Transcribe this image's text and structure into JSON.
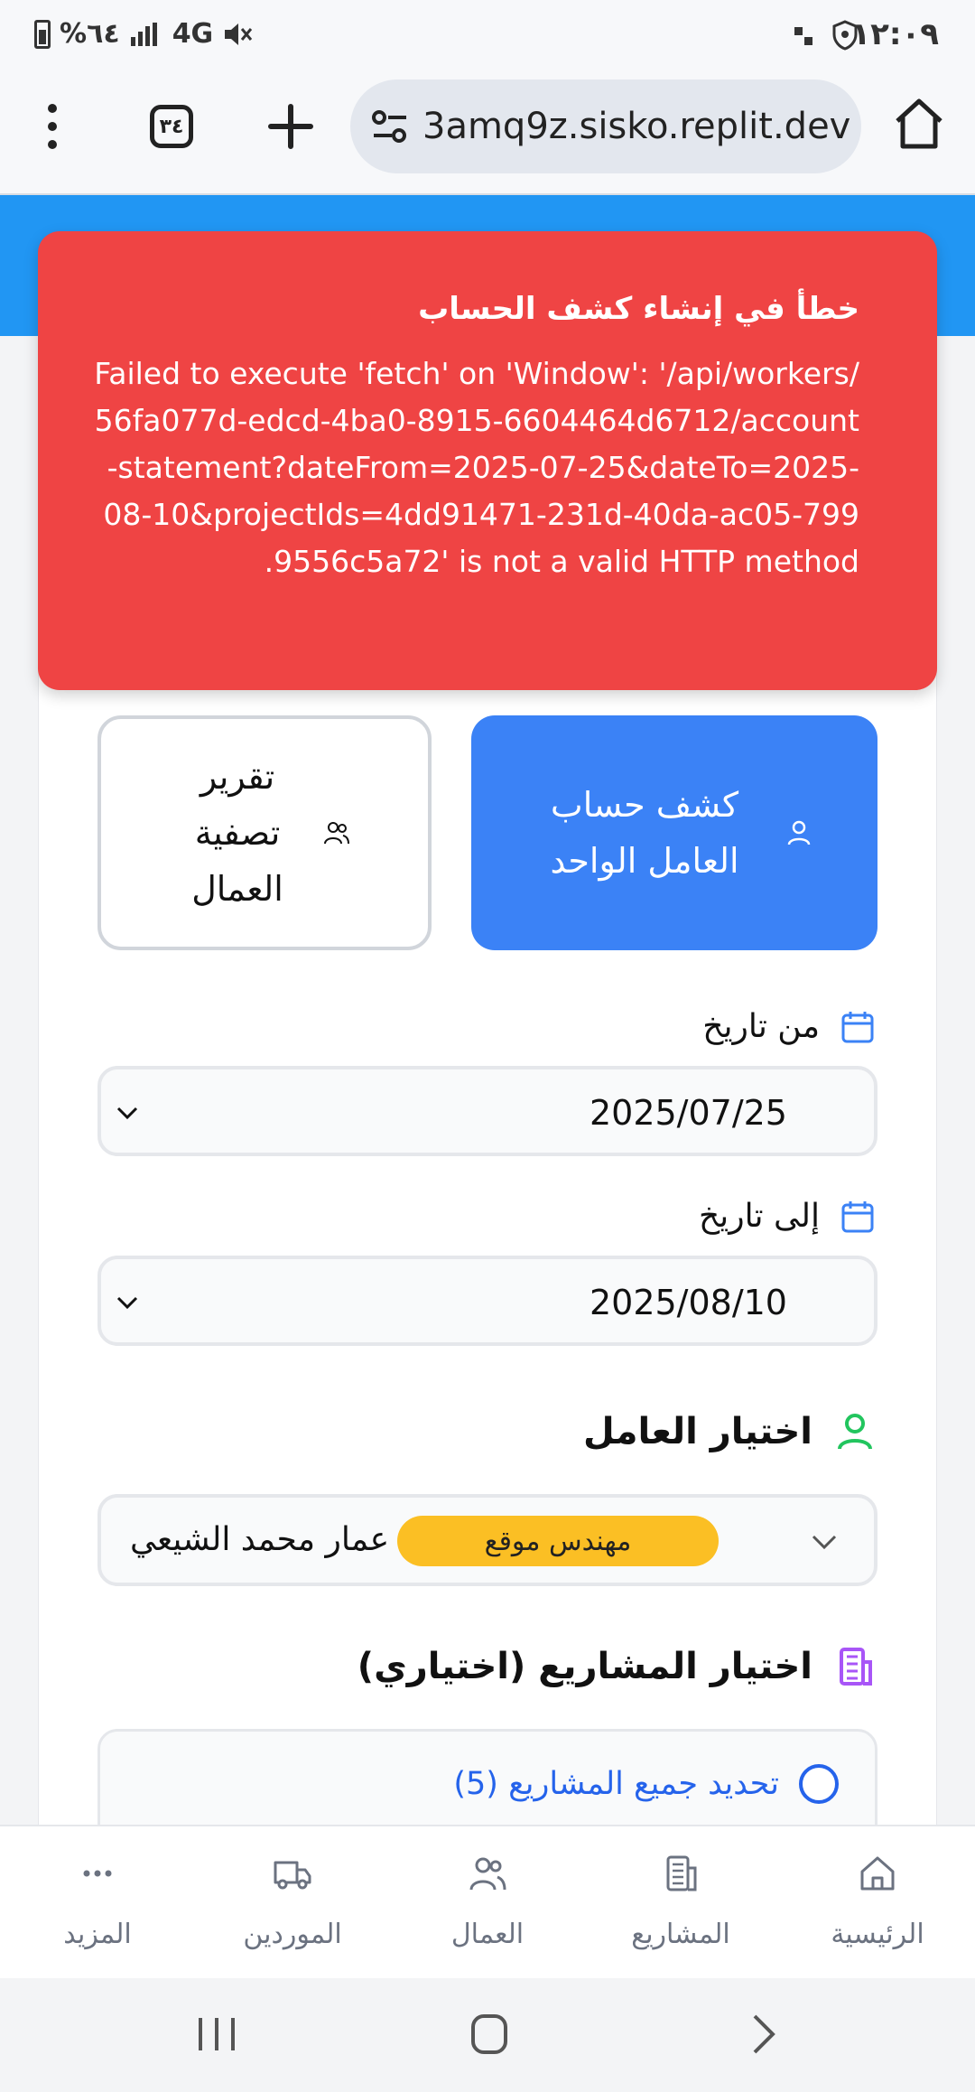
{
  "status_bar": {
    "time": "١٢:٠٩",
    "battery": "%٦٤",
    "network": "4G"
  },
  "browser": {
    "url": "3amq9z.sisko.replit.dev",
    "tab_count": "٣٤"
  },
  "toast": {
    "title": "خطأ في إنشاء كشف الحساب",
    "message": "Failed to execute 'fetch' on 'Window': '/api/workers/56fa077d-edcd-4ba0-8915-6604464d6712/account-statement?dateFrom=2025-07-25&dateTo=2025-08-10&projectIds=4dd91471-231d-40da-ac05-7999556c5a72' is not a valid HTTP method."
  },
  "report_buttons": {
    "single_worker": "كشف حساب العامل الواحد",
    "settlement": "تقرير تصفية العمال"
  },
  "date_from": {
    "label": "من تاريخ",
    "value": "2025/07/25"
  },
  "date_to": {
    "label": "إلى تاريخ",
    "value": "2025/08/10"
  },
  "worker": {
    "section_title": "اختيار العامل",
    "selected_name": "عمار محمد الشيعي",
    "role_badge": "مهندس موقع"
  },
  "projects": {
    "section_title": "اختيار المشاريع (اختياري)",
    "select_all_label": "تحديد جميع المشاريع (5)"
  },
  "bottom_nav": {
    "items": [
      {
        "label": "الرئيسية",
        "icon": "home-icon"
      },
      {
        "label": "المشاريع",
        "icon": "building-icon"
      },
      {
        "label": "العمال",
        "icon": "users-icon"
      },
      {
        "label": "الموردين",
        "icon": "truck-icon"
      },
      {
        "label": "المزيد",
        "icon": "more-icon"
      }
    ]
  },
  "colors": {
    "toast_bg": "#ef4444",
    "primary": "#3b82f6",
    "header": "#2196f3",
    "badge": "#fbbf24"
  }
}
